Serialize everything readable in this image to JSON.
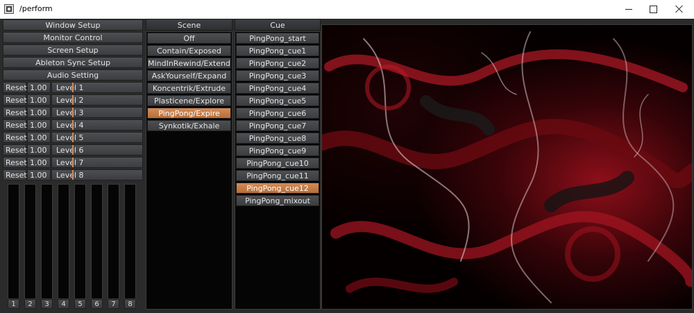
{
  "window": {
    "title": "/perform"
  },
  "left": {
    "setup_buttons": [
      "Window Setup",
      "Monitor Control",
      "Screen Setup",
      "Ableton Sync Setup",
      "Audio Setting"
    ],
    "channels": [
      {
        "reset": "Reset",
        "value": "1.00",
        "level": "Level 1"
      },
      {
        "reset": "Reset",
        "value": "1.00",
        "level": "Level 2"
      },
      {
        "reset": "Reset",
        "value": "1.00",
        "level": "Level 3"
      },
      {
        "reset": "Reset",
        "value": "1.00",
        "level": "Level 4"
      },
      {
        "reset": "Reset",
        "value": "1.00",
        "level": "Level 5"
      },
      {
        "reset": "Reset",
        "value": "1.00",
        "level": "Level 6"
      },
      {
        "reset": "Reset",
        "value": "1.00",
        "level": "Level 7"
      },
      {
        "reset": "Reset",
        "value": "1.00",
        "level": "Level 8"
      }
    ],
    "fader_numbers": [
      "1",
      "2",
      "3",
      "4",
      "5",
      "6",
      "7",
      "8"
    ]
  },
  "scene": {
    "header": "Scene",
    "items": [
      "Off",
      "Contain/Exposed",
      "MindInRewind/Extend",
      "AskYourself/Expand",
      "Koncentrik/Extrude",
      "Plasticene/Explore",
      "PingPong/Expire",
      "Synkotik/Exhale"
    ],
    "selected_index": 6
  },
  "cue": {
    "header": "Cue",
    "items": [
      "PingPong_start",
      "PingPong_cue1",
      "PingPong_cue2",
      "PingPong_cue3",
      "PingPong_cue4",
      "PingPong_cue5",
      "PingPong_cue6",
      "PingPong_cue7",
      "PingPong_cue8",
      "PingPong_cue9",
      "PingPong_cue10",
      "PingPong_cue11",
      "PingPong_cue12",
      "PingPong_mixout"
    ],
    "selected_index": 12
  },
  "colors": {
    "accent": "#c87a42",
    "background": "#2b2b2b",
    "preview_red": "#8a0d15"
  }
}
